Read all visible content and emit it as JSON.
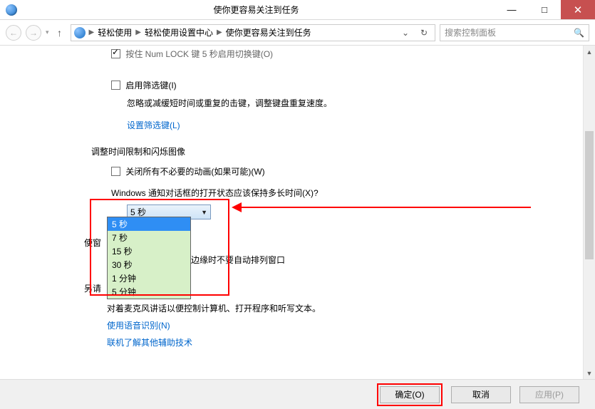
{
  "window": {
    "title": "使你更容易关注到任务"
  },
  "controls": {
    "min": "—",
    "max": "□",
    "close": "✕"
  },
  "breadcrumb": {
    "seg1": "轻松使用",
    "seg2": "轻松使用设置中心",
    "seg3": "使你更容易关注到任务"
  },
  "search": {
    "placeholder": "搜索控制面板"
  },
  "top_cut": {
    "checkbox_label": "按住 Num LOCK 键 5 秒启用切换键(O)"
  },
  "filter": {
    "checkbox": "启用筛选键(I)",
    "desc": "忽略或减缓短时间或重复的击键，调整键盘重复速度。",
    "link": "设置筛选键(L)"
  },
  "section2": {
    "header": "调整时间限制和闪烁图像",
    "anim_checkbox": "关闭所有不必要的动画(如果可能)(W)",
    "duration_label": "Windows 通知对话框的打开状态应该保持多长时间(X)?"
  },
  "combo": {
    "selected": "5 秒",
    "options": [
      "5 秒",
      "7 秒",
      "15 秒",
      "30 秒",
      "1 分钟",
      "5 分钟"
    ]
  },
  "snap": {
    "side1": "使窗",
    "side2": "另请",
    "tail": "边缘时不要自动排列窗口"
  },
  "speech": {
    "desc": "对着麦克风讲话以便控制计算机、打开程序和听写文本。",
    "link1": "使用语音识别(N)",
    "link2": "联机了解其他辅助技术"
  },
  "footer": {
    "ok": "确定(O)",
    "cancel": "取消",
    "apply": "应用(P)"
  }
}
